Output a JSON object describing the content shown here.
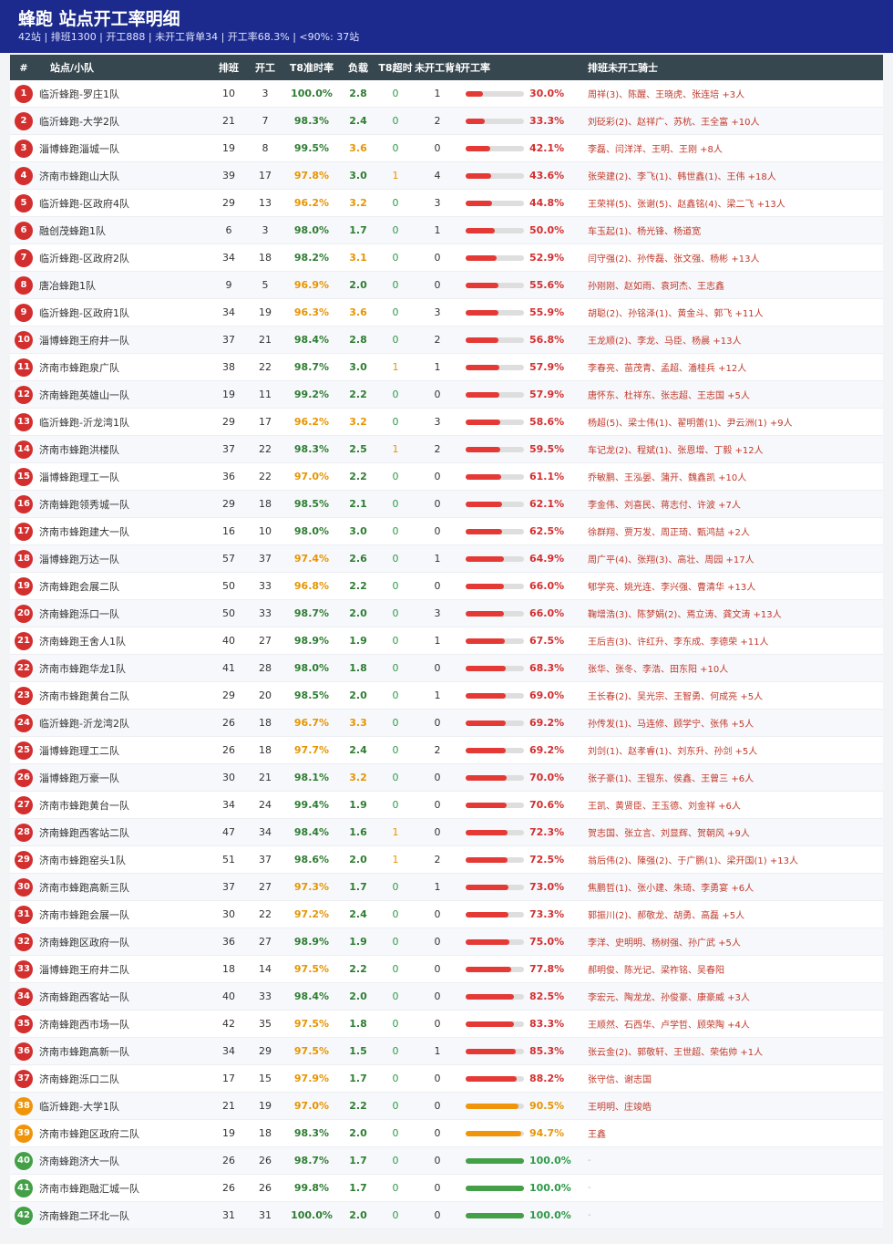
{
  "header": {
    "title": "蜂跑  站点开工率明细",
    "subtitle": "42站 | 排班1300 | 开工888 | 未开工背单34 | 开工率68.3% | <90%: 37站"
  },
  "columns": {
    "idx": "#",
    "name": "站点/小队",
    "sched": "排班",
    "work": "开工",
    "t8": "T8准时率",
    "load": "负载",
    "over": "T8超时",
    "unstarted": "未开工背单",
    "rate": "开工率",
    "riders": "排班未开工骑士"
  },
  "colors": {
    "red": "#d32f2f",
    "orange": "#f0940a",
    "green": "#43a047",
    "header_bg": "#1b2a8c"
  },
  "rows": [
    {
      "idx": "1",
      "name": "临沂蜂跑-罗庄1队",
      "sched": "10",
      "work": "3",
      "t8": "100.0%",
      "load": "2.8",
      "over": "0",
      "unstarted": "1",
      "rate": "30.0%",
      "rate_value": 30.0,
      "riders": "周祥(3)、陈醒、王晓虎、张连培 +3人"
    },
    {
      "idx": "2",
      "name": "临沂蜂跑-大学2队",
      "sched": "21",
      "work": "7",
      "t8": "98.3%",
      "load": "2.4",
      "over": "0",
      "unstarted": "2",
      "rate": "33.3%",
      "rate_value": 33.3,
      "riders": "刘砭彩(2)、赵祥广、苏杭、王全富 +10人"
    },
    {
      "idx": "3",
      "name": "淄博蜂跑淄城一队",
      "sched": "19",
      "work": "8",
      "t8": "99.5%",
      "load": "3.6",
      "over": "0",
      "unstarted": "0",
      "rate": "42.1%",
      "rate_value": 42.1,
      "riders": "李磊、闫洋洋、王明、王刚 +8人"
    },
    {
      "idx": "4",
      "name": "济南市蜂跑山大队",
      "sched": "39",
      "work": "17",
      "t8": "97.8%",
      "load": "3.0",
      "over": "1",
      "unstarted": "4",
      "rate": "43.6%",
      "rate_value": 43.6,
      "riders": "张荣建(2)、李飞(1)、韩世鑫(1)、王伟 +18人"
    },
    {
      "idx": "5",
      "name": "临沂蜂跑-区政府4队",
      "sched": "29",
      "work": "13",
      "t8": "96.2%",
      "load": "3.2",
      "over": "0",
      "unstarted": "3",
      "rate": "44.8%",
      "rate_value": 44.8,
      "riders": "王荣祥(5)、张谢(5)、赵鑫铭(4)、梁二飞 +13人"
    },
    {
      "idx": "6",
      "name": "融创茂蜂跑1队",
      "sched": "6",
      "work": "3",
      "t8": "98.0%",
      "load": "1.7",
      "over": "0",
      "unstarted": "1",
      "rate": "50.0%",
      "rate_value": 50.0,
      "riders": "车玉起(1)、杨光锋、杨道宽"
    },
    {
      "idx": "7",
      "name": "临沂蜂跑-区政府2队",
      "sched": "34",
      "work": "18",
      "t8": "98.2%",
      "load": "3.1",
      "over": "0",
      "unstarted": "0",
      "rate": "52.9%",
      "rate_value": 52.9,
      "riders": "闫守强(2)、孙传磊、张文强、杨彬 +13人"
    },
    {
      "idx": "8",
      "name": "唐冶蜂跑1队",
      "sched": "9",
      "work": "5",
      "t8": "96.9%",
      "load": "2.0",
      "over": "0",
      "unstarted": "0",
      "rate": "55.6%",
      "rate_value": 55.6,
      "riders": "孙刚刚、赵如雨、袁珂杰、王志鑫"
    },
    {
      "idx": "9",
      "name": "临沂蜂跑-区政府1队",
      "sched": "34",
      "work": "19",
      "t8": "96.3%",
      "load": "3.6",
      "over": "0",
      "unstarted": "3",
      "rate": "55.9%",
      "rate_value": 55.9,
      "riders": "胡聪(2)、孙铭泽(1)、黄金斗、郭飞 +11人"
    },
    {
      "idx": "10",
      "name": "淄博蜂跑王府井一队",
      "sched": "37",
      "work": "21",
      "t8": "98.4%",
      "load": "2.8",
      "over": "0",
      "unstarted": "2",
      "rate": "56.8%",
      "rate_value": 56.8,
      "riders": "王龙顺(2)、李龙、马臣、杨晨 +13人"
    },
    {
      "idx": "11",
      "name": "济南市蜂跑泉广队",
      "sched": "38",
      "work": "22",
      "t8": "98.7%",
      "load": "3.0",
      "over": "1",
      "unstarted": "1",
      "rate": "57.9%",
      "rate_value": 57.9,
      "riders": "李春亮、苗茂青、孟超、潘桂兵 +12人"
    },
    {
      "idx": "12",
      "name": "济南蜂跑英雄山一队",
      "sched": "19",
      "work": "11",
      "t8": "99.2%",
      "load": "2.2",
      "over": "0",
      "unstarted": "0",
      "rate": "57.9%",
      "rate_value": 57.9,
      "riders": "唐怀东、杜祥东、张志超、王志国 +5人"
    },
    {
      "idx": "13",
      "name": "临沂蜂跑-沂龙湾1队",
      "sched": "29",
      "work": "17",
      "t8": "96.2%",
      "load": "3.2",
      "over": "0",
      "unstarted": "3",
      "rate": "58.6%",
      "rate_value": 58.6,
      "riders": "杨超(5)、梁士伟(1)、翟明蕾(1)、尹云洲(1) +9人"
    },
    {
      "idx": "14",
      "name": "济南市蜂跑洪楼队",
      "sched": "37",
      "work": "22",
      "t8": "98.3%",
      "load": "2.5",
      "over": "1",
      "unstarted": "2",
      "rate": "59.5%",
      "rate_value": 59.5,
      "riders": "车记龙(2)、程斌(1)、张恩增、丁毅 +12人"
    },
    {
      "idx": "15",
      "name": "淄博蜂跑理工一队",
      "sched": "36",
      "work": "22",
      "t8": "97.0%",
      "load": "2.2",
      "over": "0",
      "unstarted": "0",
      "rate": "61.1%",
      "rate_value": 61.1,
      "riders": "乔敏鹏、王泓晏、蒲开、魏鑫凯 +10人"
    },
    {
      "idx": "16",
      "name": "济南蜂跑领秀城一队",
      "sched": "29",
      "work": "18",
      "t8": "98.5%",
      "load": "2.1",
      "over": "0",
      "unstarted": "0",
      "rate": "62.1%",
      "rate_value": 62.1,
      "riders": "李金伟、刘喜民、蒋志付、许波 +7人"
    },
    {
      "idx": "17",
      "name": "济南市蜂跑建大一队",
      "sched": "16",
      "work": "10",
      "t8": "98.0%",
      "load": "3.0",
      "over": "0",
      "unstarted": "0",
      "rate": "62.5%",
      "rate_value": 62.5,
      "riders": "徐群翔、贾万发、周正琦、甄鸿喆 +2人"
    },
    {
      "idx": "18",
      "name": "淄博蜂跑万达一队",
      "sched": "57",
      "work": "37",
      "t8": "97.4%",
      "load": "2.6",
      "over": "0",
      "unstarted": "1",
      "rate": "64.9%",
      "rate_value": 64.9,
      "riders": "周广平(4)、张翔(3)、高壮、周园 +17人"
    },
    {
      "idx": "19",
      "name": "济南蜂跑会展二队",
      "sched": "50",
      "work": "33",
      "t8": "96.8%",
      "load": "2.2",
      "over": "0",
      "unstarted": "0",
      "rate": "66.0%",
      "rate_value": 66.0,
      "riders": "郇学亮、姚光连、李兴强、曹清华 +13人"
    },
    {
      "idx": "20",
      "name": "济南蜂跑泺口一队",
      "sched": "50",
      "work": "33",
      "t8": "98.7%",
      "load": "2.0",
      "over": "0",
      "unstarted": "3",
      "rate": "66.0%",
      "rate_value": 66.0,
      "riders": "鞠增浩(3)、陈梦娟(2)、焉立涛、龚文涛 +13人"
    },
    {
      "idx": "21",
      "name": "济南蜂跑王舍人1队",
      "sched": "40",
      "work": "27",
      "t8": "98.9%",
      "load": "1.9",
      "over": "0",
      "unstarted": "1",
      "rate": "67.5%",
      "rate_value": 67.5,
      "riders": "王后吉(3)、许红升、李东成、李德荣 +11人"
    },
    {
      "idx": "22",
      "name": "济南市蜂跑华龙1队",
      "sched": "41",
      "work": "28",
      "t8": "98.0%",
      "load": "1.8",
      "over": "0",
      "unstarted": "0",
      "rate": "68.3%",
      "rate_value": 68.3,
      "riders": "张华、张冬、李浩、田东阳 +10人"
    },
    {
      "idx": "23",
      "name": "济南市蜂跑黄台二队",
      "sched": "29",
      "work": "20",
      "t8": "98.5%",
      "load": "2.0",
      "over": "0",
      "unstarted": "1",
      "rate": "69.0%",
      "rate_value": 69.0,
      "riders": "王长春(2)、吴光宗、王智勇、何成亮 +5人"
    },
    {
      "idx": "24",
      "name": "临沂蜂跑-沂龙湾2队",
      "sched": "26",
      "work": "18",
      "t8": "96.7%",
      "load": "3.3",
      "over": "0",
      "unstarted": "0",
      "rate": "69.2%",
      "rate_value": 69.2,
      "riders": "孙传发(1)、马连修、顾学宁、张伟 +5人"
    },
    {
      "idx": "25",
      "name": "淄博蜂跑理工二队",
      "sched": "26",
      "work": "18",
      "t8": "97.7%",
      "load": "2.4",
      "over": "0",
      "unstarted": "2",
      "rate": "69.2%",
      "rate_value": 69.2,
      "riders": "刘剑(1)、赵孝睿(1)、刘东升、孙剑 +5人"
    },
    {
      "idx": "26",
      "name": "淄博蜂跑万豪一队",
      "sched": "30",
      "work": "21",
      "t8": "98.1%",
      "load": "3.2",
      "over": "0",
      "unstarted": "0",
      "rate": "70.0%",
      "rate_value": 70.0,
      "riders": "张子豪(1)、王锟东、侯鑫、王曾三 +6人"
    },
    {
      "idx": "27",
      "name": "济南市蜂跑黄台一队",
      "sched": "34",
      "work": "24",
      "t8": "99.4%",
      "load": "1.9",
      "over": "0",
      "unstarted": "0",
      "rate": "70.6%",
      "rate_value": 70.6,
      "riders": "王凯、黄贤臣、王玉德、刘金祥 +6人"
    },
    {
      "idx": "28",
      "name": "济南蜂跑西客站二队",
      "sched": "47",
      "work": "34",
      "t8": "98.4%",
      "load": "1.6",
      "over": "1",
      "unstarted": "0",
      "rate": "72.3%",
      "rate_value": 72.3,
      "riders": "贺志国、张立言、刘显辉、贺朝风 +9人"
    },
    {
      "idx": "29",
      "name": "济南市蜂跑窑头1队",
      "sched": "51",
      "work": "37",
      "t8": "98.6%",
      "load": "2.0",
      "over": "1",
      "unstarted": "2",
      "rate": "72.5%",
      "rate_value": 72.5,
      "riders": "翁后伟(2)、陳强(2)、于广鹏(1)、梁开国(1) +13人"
    },
    {
      "idx": "30",
      "name": "济南市蜂跑高新三队",
      "sched": "37",
      "work": "27",
      "t8": "97.3%",
      "load": "1.7",
      "over": "0",
      "unstarted": "1",
      "rate": "73.0%",
      "rate_value": 73.0,
      "riders": "焦鹏哲(1)、张小建、朱琦、李勇宴 +6人"
    },
    {
      "idx": "31",
      "name": "济南市蜂跑会展一队",
      "sched": "30",
      "work": "22",
      "t8": "97.2%",
      "load": "2.4",
      "over": "0",
      "unstarted": "0",
      "rate": "73.3%",
      "rate_value": 73.3,
      "riders": "郭振川(2)、郝敬龙、胡勇、高磊 +5人"
    },
    {
      "idx": "32",
      "name": "济南蜂跑区政府一队",
      "sched": "36",
      "work": "27",
      "t8": "98.9%",
      "load": "1.9",
      "over": "0",
      "unstarted": "0",
      "rate": "75.0%",
      "rate_value": 75.0,
      "riders": "李洋、史明明、杨树强、孙广武 +5人"
    },
    {
      "idx": "33",
      "name": "淄博蜂跑王府井二队",
      "sched": "18",
      "work": "14",
      "t8": "97.5%",
      "load": "2.2",
      "over": "0",
      "unstarted": "0",
      "rate": "77.8%",
      "rate_value": 77.8,
      "riders": "郝明俊、陈光记、梁祚铭、吴春阳"
    },
    {
      "idx": "34",
      "name": "济南蜂跑西客站一队",
      "sched": "40",
      "work": "33",
      "t8": "98.4%",
      "load": "2.0",
      "over": "0",
      "unstarted": "0",
      "rate": "82.5%",
      "rate_value": 82.5,
      "riders": "李宏元、陶龙龙、孙俊豪、康豪威 +3人"
    },
    {
      "idx": "35",
      "name": "济南蜂跑西市场一队",
      "sched": "42",
      "work": "35",
      "t8": "97.5%",
      "load": "1.8",
      "over": "0",
      "unstarted": "0",
      "rate": "83.3%",
      "rate_value": 83.3,
      "riders": "王顺然、石西华、卢学哲、顾荣陶 +4人"
    },
    {
      "idx": "36",
      "name": "济南市蜂跑高新一队",
      "sched": "34",
      "work": "29",
      "t8": "97.5%",
      "load": "1.5",
      "over": "0",
      "unstarted": "1",
      "rate": "85.3%",
      "rate_value": 85.3,
      "riders": "张云金(2)、郭敬轩、王世超、荣佑帅 +1人"
    },
    {
      "idx": "37",
      "name": "济南蜂跑泺口二队",
      "sched": "17",
      "work": "15",
      "t8": "97.9%",
      "load": "1.7",
      "over": "0",
      "unstarted": "0",
      "rate": "88.2%",
      "rate_value": 88.2,
      "riders": "张守信、谢志国"
    },
    {
      "idx": "38",
      "name": "临沂蜂跑-大学1队",
      "sched": "21",
      "work": "19",
      "t8": "97.0%",
      "load": "2.2",
      "over": "0",
      "unstarted": "0",
      "rate": "90.5%",
      "rate_value": 90.5,
      "riders": "王明明、庄竣皓"
    },
    {
      "idx": "39",
      "name": "济南市蜂跑区政府二队",
      "sched": "19",
      "work": "18",
      "t8": "98.3%",
      "load": "2.0",
      "over": "0",
      "unstarted": "0",
      "rate": "94.7%",
      "rate_value": 94.7,
      "riders": "王鑫"
    },
    {
      "idx": "40",
      "name": "济南蜂跑济大一队",
      "sched": "26",
      "work": "26",
      "t8": "98.7%",
      "load": "1.7",
      "over": "0",
      "unstarted": "0",
      "rate": "100.0%",
      "rate_value": 100.0,
      "riders": "-"
    },
    {
      "idx": "41",
      "name": "济南市蜂跑融汇城一队",
      "sched": "26",
      "work": "26",
      "t8": "99.8%",
      "load": "1.7",
      "over": "0",
      "unstarted": "0",
      "rate": "100.0%",
      "rate_value": 100.0,
      "riders": "-"
    },
    {
      "idx": "42",
      "name": "济南蜂跑二环北一队",
      "sched": "31",
      "work": "31",
      "t8": "100.0%",
      "load": "2.0",
      "over": "0",
      "unstarted": "0",
      "rate": "100.0%",
      "rate_value": 100.0,
      "riders": "-"
    }
  ]
}
